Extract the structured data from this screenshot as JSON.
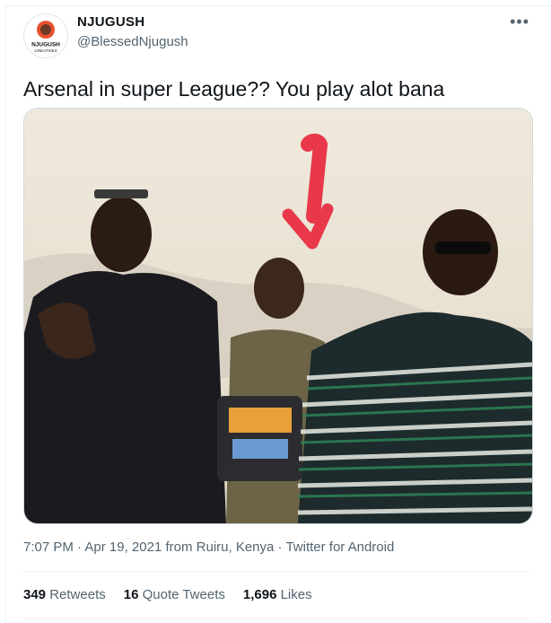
{
  "author": {
    "name": "NJUGUSH",
    "handle": "@BlessedNjugush",
    "avatar_text": "NJUGUSH CREATIVES"
  },
  "tweet": {
    "text": "Arsenal in super League?? You play alot bana",
    "time": "7:07 PM",
    "date": "Apr 19, 2021",
    "from_label": "from",
    "location": "Ruiru, Kenya",
    "client": "Twitter for Android",
    "separator": "·"
  },
  "stats": {
    "retweets_count": "349",
    "retweets_label": "Retweets",
    "quotes_count": "16",
    "quotes_label": "Quote Tweets",
    "likes_count": "1,696",
    "likes_label": "Likes"
  },
  "icons": {
    "more": "more-icon",
    "arrow": "red-arrow"
  },
  "colors": {
    "text": "#0f1419",
    "secondary": "#536471",
    "arrow_red": "#e8384a"
  }
}
